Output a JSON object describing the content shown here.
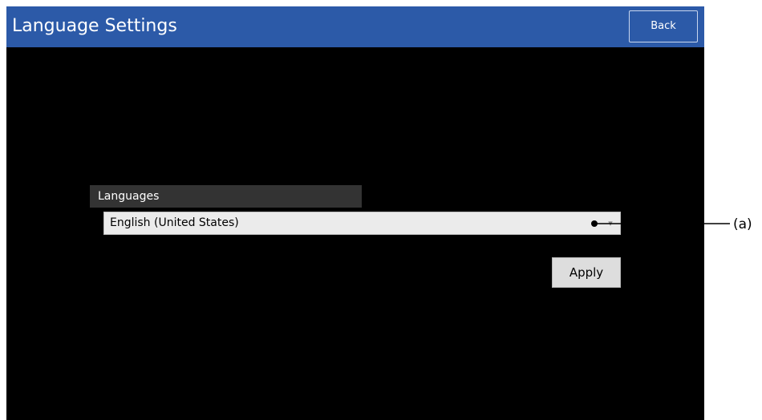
{
  "window": {
    "title": "Language Settings",
    "back_label": "Back"
  },
  "languages": {
    "header": "Languages",
    "selected_value": "English (United States)",
    "dropdown_icon": "chevron-down-icon"
  },
  "actions": {
    "apply_label": "Apply"
  },
  "callout": {
    "label": "(a)"
  },
  "colors": {
    "title_bar": "#2c5aa8",
    "screen_background": "#000000",
    "header_background": "#333333",
    "select_background": "#ebebeb",
    "button_background": "#dddddd"
  }
}
